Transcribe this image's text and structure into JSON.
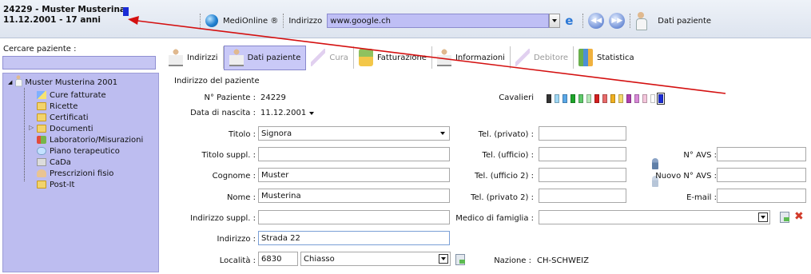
{
  "header": {
    "patient_line1": "24229 - Muster Musterina",
    "patient_line2": "11.12.2001 - 17 anni",
    "tag_color": "#1a2bd6",
    "brand": "MediOnline ®",
    "address_label": "Indirizzo",
    "url": "www.google.ch",
    "patient_data_label": "Dati paziente",
    "icons": [
      "globe-icon",
      "ie-icon",
      "back-icon",
      "forward-icon",
      "doctor-icon"
    ]
  },
  "search": {
    "label": "Cercare paziente :",
    "value": ""
  },
  "tree": {
    "root": "Muster Musterina 2001",
    "items": [
      {
        "label": "Cure fatturate",
        "icon": "care-icon"
      },
      {
        "label": "Ricette",
        "icon": "folder-icon"
      },
      {
        "label": "Certificati",
        "icon": "certificate-icon"
      },
      {
        "label": "Documenti",
        "icon": "folder-icon"
      },
      {
        "label": "Laboratorio/Misurazioni",
        "icon": "lab-icon"
      },
      {
        "label": "Piano terapeutico",
        "icon": "pill-icon"
      },
      {
        "label": "CaDa",
        "icon": "card-icon"
      },
      {
        "label": "Prescrizioni fisio",
        "icon": "physio-icon"
      },
      {
        "label": "Post-It",
        "icon": "folder-icon"
      }
    ]
  },
  "tabs": [
    {
      "label": "Indirizzi",
      "state": "normal"
    },
    {
      "label": "Dati paziente",
      "state": "active"
    },
    {
      "label": "Cura",
      "state": "disabled"
    },
    {
      "label": "Fatturazione",
      "state": "normal"
    },
    {
      "label": "Informazioni",
      "state": "normal"
    },
    {
      "label": "Debitore",
      "state": "disabled"
    },
    {
      "label": "Statistica",
      "state": "normal"
    }
  ],
  "form": {
    "section_title": "Indirizzo del paziente",
    "patient_no_label": "N° Paziente :",
    "patient_no": "24229",
    "birth_label": "Data di nascita :",
    "birth": "11.12.2001",
    "title_label": "Titolo :",
    "title": "Signora",
    "title_suppl_label": "Titolo suppl. :",
    "title_suppl": "",
    "surname_label": "Cognome :",
    "surname": "Muster",
    "name_label": "Nome :",
    "name": "Musterina",
    "addr_suppl_label": "Indirizzo suppl. :",
    "addr_suppl": "",
    "address_label": "Indirizzo :",
    "address": "Strada 22",
    "locality_label": "Località :",
    "zip": "6830",
    "city": "Chiasso",
    "nation_label": "Nazione :",
    "nation": "CH-SCHWEIZ",
    "cavalieri_label": "Cavalieri",
    "cavalieri_colors": [
      "#333333",
      "#9fd8f5",
      "#5aa8e8",
      "#1ea52a",
      "#5ec96a",
      "#b6e8b8",
      "#d42020",
      "#e86a6a",
      "#f0b020",
      "#f2d86c",
      "#b040b0",
      "#d98ad8",
      "#f4c6dc",
      "#ffffff",
      "#1a2bd6"
    ],
    "phone_priv_label": "Tel. (privato) :",
    "phone_priv": "",
    "phone_office_label": "Tel. (ufficio) :",
    "phone_office": "",
    "phone_office2_label": "Tel. (ufficio 2) :",
    "phone_office2": "",
    "phone_priv2_label": "Tel. (privato 2) :",
    "phone_priv2": "",
    "family_doctor_label": "Medico di famiglia :",
    "family_doctor": "",
    "avs_label": "N° AVS :",
    "avs": "",
    "new_avs_label": "Nuovo N° AVS :",
    "new_avs": "",
    "email_label": "E-mail :",
    "email": ""
  },
  "annotation_color": "#d41010"
}
